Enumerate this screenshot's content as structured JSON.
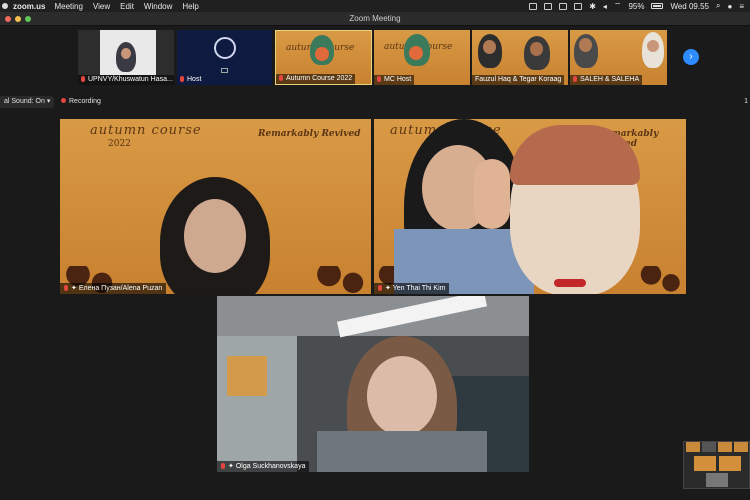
{
  "menubar": {
    "app": "zoom.us",
    "items": [
      "Meeting",
      "View",
      "Edit",
      "Window",
      "Help"
    ],
    "battery": "95%",
    "clock": "Wed 09.55"
  },
  "window": {
    "title": "Zoom Meeting"
  },
  "thumbnails": [
    {
      "label": "UPNVY/Khuswatun Hasa..."
    },
    {
      "label": "Host"
    },
    {
      "label": "Autumn Course 2022"
    },
    {
      "label": "MC Host"
    },
    {
      "label": "Fauzul Haq & Tegar Koraag"
    },
    {
      "label": "SALEH & SALEHA"
    }
  ],
  "status": {
    "original_sound": "al Sound: On",
    "recording": "Recording",
    "right_digit": "1"
  },
  "banner": {
    "autumn": "autumn course",
    "year": "2022",
    "tagline": "Remarkably Revived"
  },
  "tiles": [
    {
      "label": "Елена Пузан/Alena Puzan"
    },
    {
      "label": "Yen Thai Thi Kim"
    },
    {
      "label": "Olga Suckhanovskaya"
    }
  ],
  "colors": {
    "accent": "#2d8cff",
    "recording": "#e2463f",
    "background": "#1a1a1a",
    "banner": "#d48f3a"
  }
}
